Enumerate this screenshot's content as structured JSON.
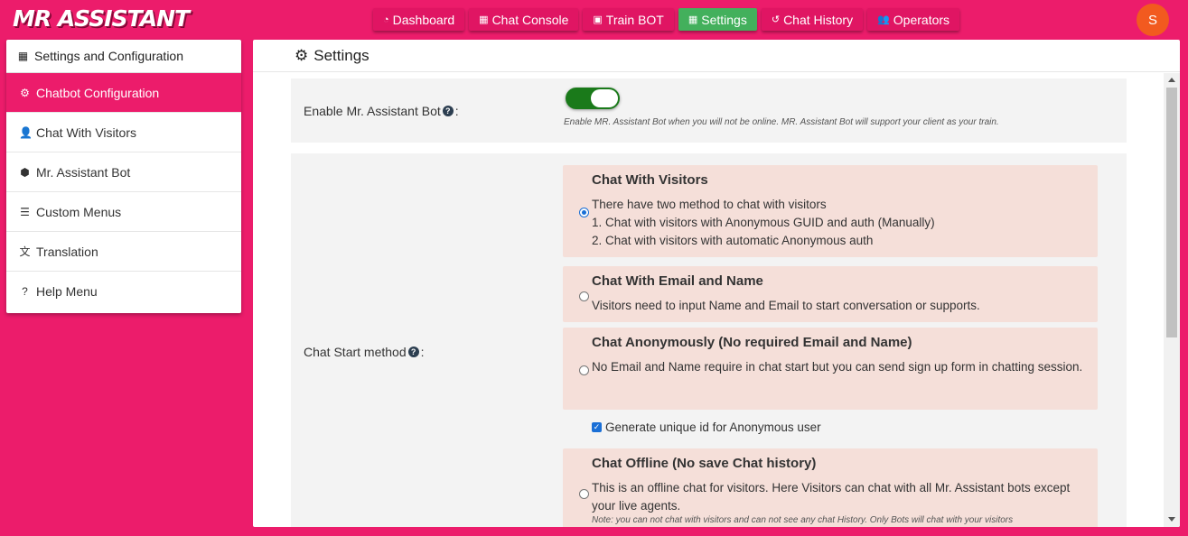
{
  "app": {
    "logo": "MR ASSISTANT",
    "avatar_initial": "S"
  },
  "nav": [
    {
      "label": "Dashboard",
      "icon": "dashboard-icon",
      "glyph": "◔"
    },
    {
      "label": "Chat Console",
      "icon": "console-icon",
      "glyph": "▦"
    },
    {
      "label": "Train BOT",
      "icon": "robot-icon",
      "glyph": "▣"
    },
    {
      "label": "Settings",
      "icon": "settings-icon",
      "glyph": "▦"
    },
    {
      "label": "Chat History",
      "icon": "history-icon",
      "glyph": "↺"
    },
    {
      "label": "Operators",
      "icon": "users-icon",
      "glyph": "👥"
    }
  ],
  "sidebar": {
    "header": "Settings and Configuration",
    "items": [
      {
        "label": "Chatbot Configuration",
        "icon": "gear-icon",
        "glyph": "⚙"
      },
      {
        "label": "Chat With Visitors",
        "icon": "user-icon",
        "glyph": "👤"
      },
      {
        "label": "Mr. Assistant Bot",
        "icon": "hexagon-icon",
        "glyph": "⬢"
      },
      {
        "label": "Custom Menus",
        "icon": "list-icon",
        "glyph": "☰"
      },
      {
        "label": "Translation",
        "icon": "translate-icon",
        "glyph": "文"
      },
      {
        "label": "Help Menu",
        "icon": "help-circle-icon",
        "glyph": "?"
      }
    ]
  },
  "main": {
    "title": "Settings",
    "enable_bot": {
      "label": "Enable Mr. Assistant Bot",
      "colon": ":",
      "hint": "Enable MR. Assistant Bot when you will not be online. MR. Assistant Bot will support your client as your train.",
      "enabled": true
    },
    "chat_start": {
      "label": "Chat Start method",
      "colon": ":",
      "options": [
        {
          "title": "Chat With Visitors",
          "lines": [
            "There have two method to chat with visitors",
            "1. Chat with visitors with Anonymous GUID and auth (Manually)",
            "2. Chat with visitors with automatic Anonymous auth"
          ],
          "checked": true
        },
        {
          "title": "Chat With Email and Name",
          "lines": [
            "Visitors need to input Name and Email to start conversation or supports."
          ],
          "checked": false
        },
        {
          "title": "Chat Anonymously (No required Email and Name)",
          "lines": [
            "No Email and Name require in chat start but you can send sign up form in chatting session."
          ],
          "checked": false
        },
        {
          "title": "Chat Offline (No save Chat history)",
          "lines": [
            "This is an offline chat for visitors. Here Visitors can chat with all Mr. Assistant bots except your live agents."
          ],
          "note": "Note: you can not chat with visitors and can not see any chat History. Only Bots will chat with your visitors",
          "checked": false
        }
      ],
      "anon_checkbox": {
        "label": "Generate unique id for Anonymous user",
        "checked": true
      }
    }
  },
  "colors": {
    "brand": "#ec1c6b",
    "active_nav": "#43b05c",
    "option_bg": "#f5dfd9"
  }
}
